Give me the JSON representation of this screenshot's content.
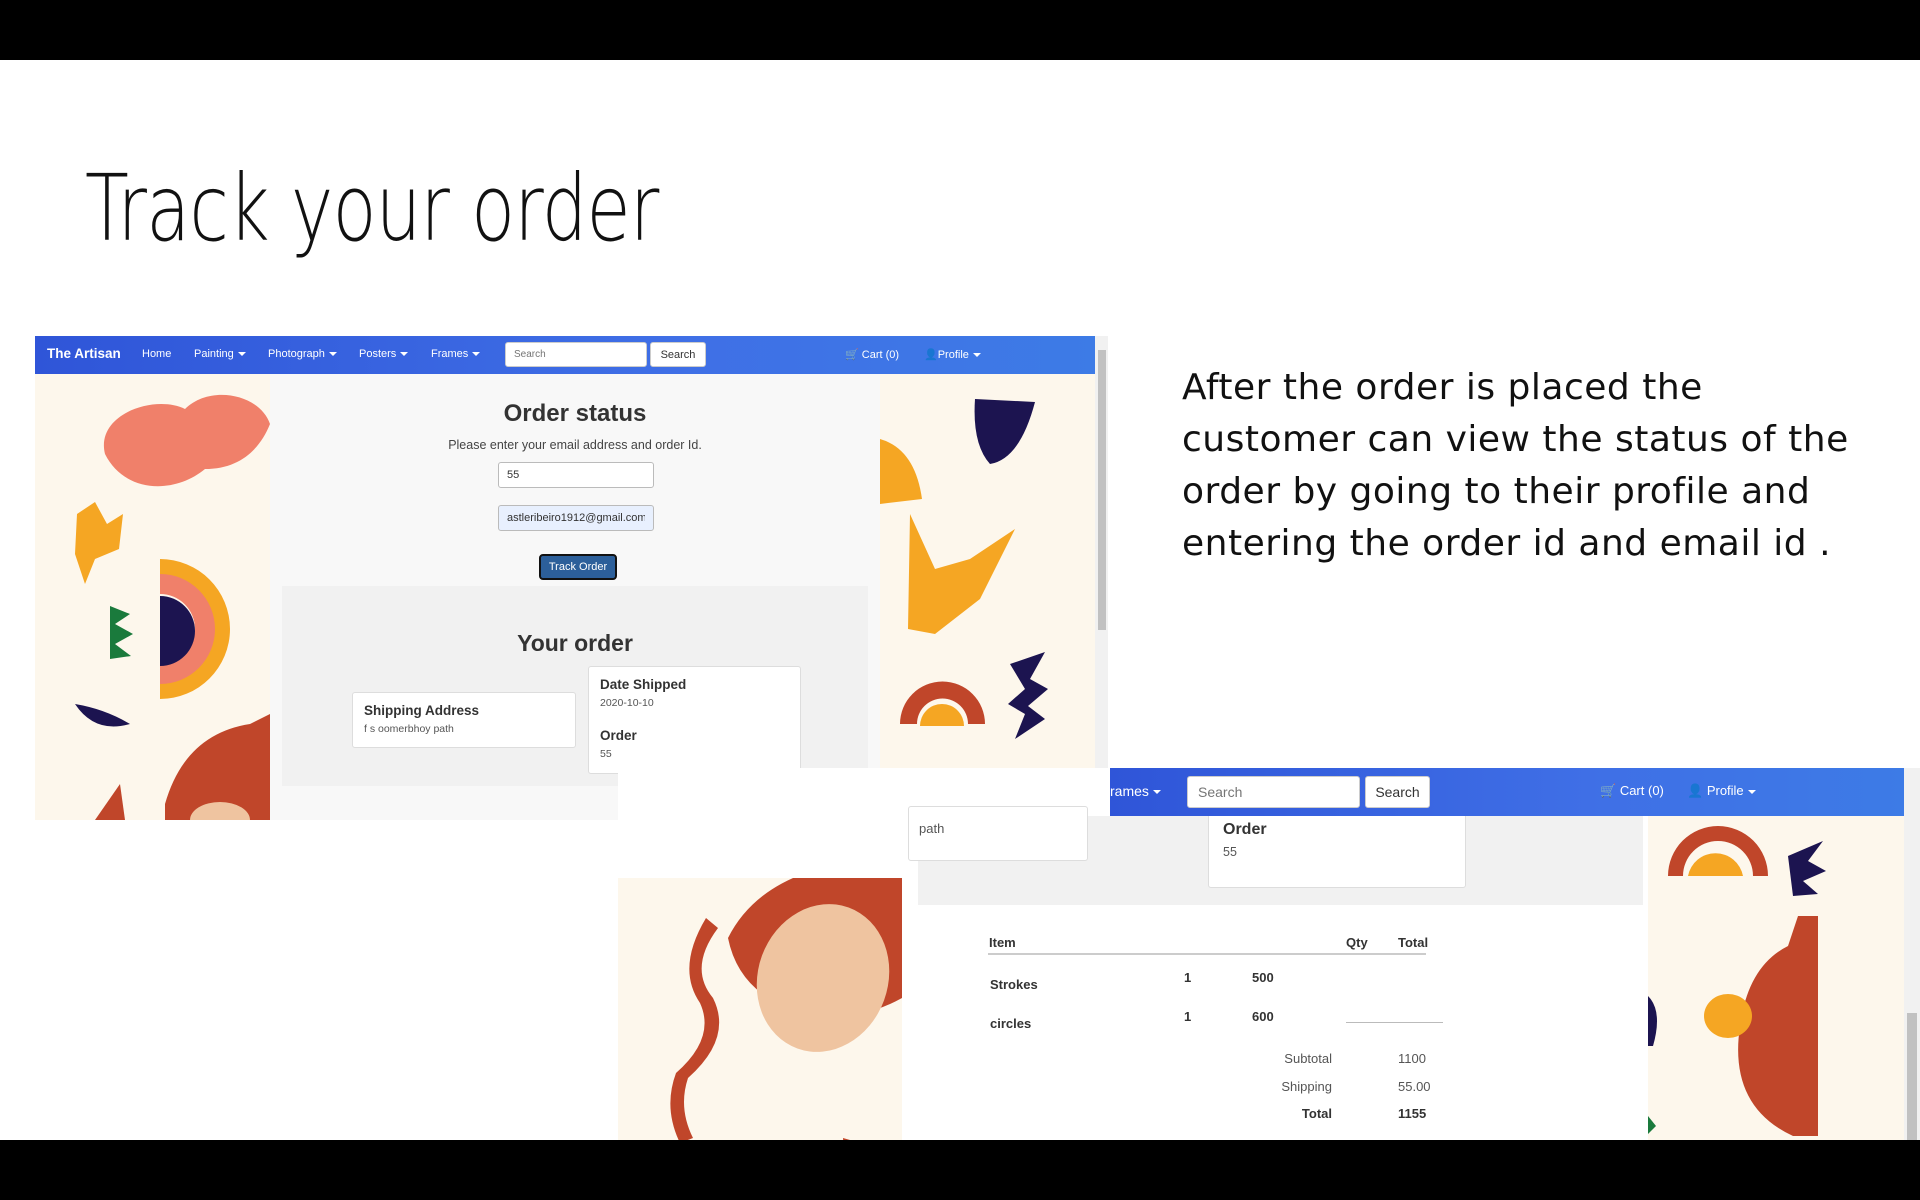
{
  "slide": {
    "title": "Track your order",
    "description": "After the order is placed the customer can view the status of the order by going to their profile and entering the order id and email id ."
  },
  "navbar": {
    "brand": "The Artisan",
    "home": "Home",
    "painting": "Painting",
    "photograph": "Photograph",
    "posters": "Posters",
    "frames": "Frames",
    "frames_partial": "rames",
    "search_placeholder": "Search",
    "search_button": "Search",
    "cart": "Cart (0)",
    "profile": "Profile"
  },
  "order_status": {
    "title": "Order status",
    "hint": "Please enter your email address and order Id.",
    "order_id_value": "55",
    "email_value": "astleribeiro1912@gmail.com",
    "track_button": "Track Order"
  },
  "your_order": {
    "title": "Your order",
    "shipping_address_label": "Shipping Address",
    "shipping_address_value": "f s oomerbhoy path",
    "shipping_address_partial": "path",
    "date_shipped_label": "Date Shipped",
    "date_shipped_value": "2020-10-10",
    "order_label": "Order",
    "order_value": "55"
  },
  "order_table": {
    "headers": {
      "item": "Item",
      "qty": "Qty",
      "total": "Total"
    },
    "rows": [
      {
        "item": "Strokes",
        "qty": "1",
        "total": "500"
      },
      {
        "item": "circles",
        "qty": "1",
        "total": "600"
      }
    ],
    "subtotal_label": "Subtotal",
    "subtotal_value": "1100",
    "shipping_label": "Shipping",
    "shipping_value": "55.00",
    "total_label": "Total",
    "total_value": "1155"
  },
  "colors": {
    "navbar": "#3f6fe6",
    "track_button": "#2c5f9a",
    "background_panel": "#fdf7ec",
    "coral": "#f0806a",
    "orange": "#f5a623",
    "navy": "#1c1450",
    "rust": "#c0462a",
    "green": "#1a7a3c",
    "peach": "#efc4a0",
    "red": "#d9262b"
  }
}
